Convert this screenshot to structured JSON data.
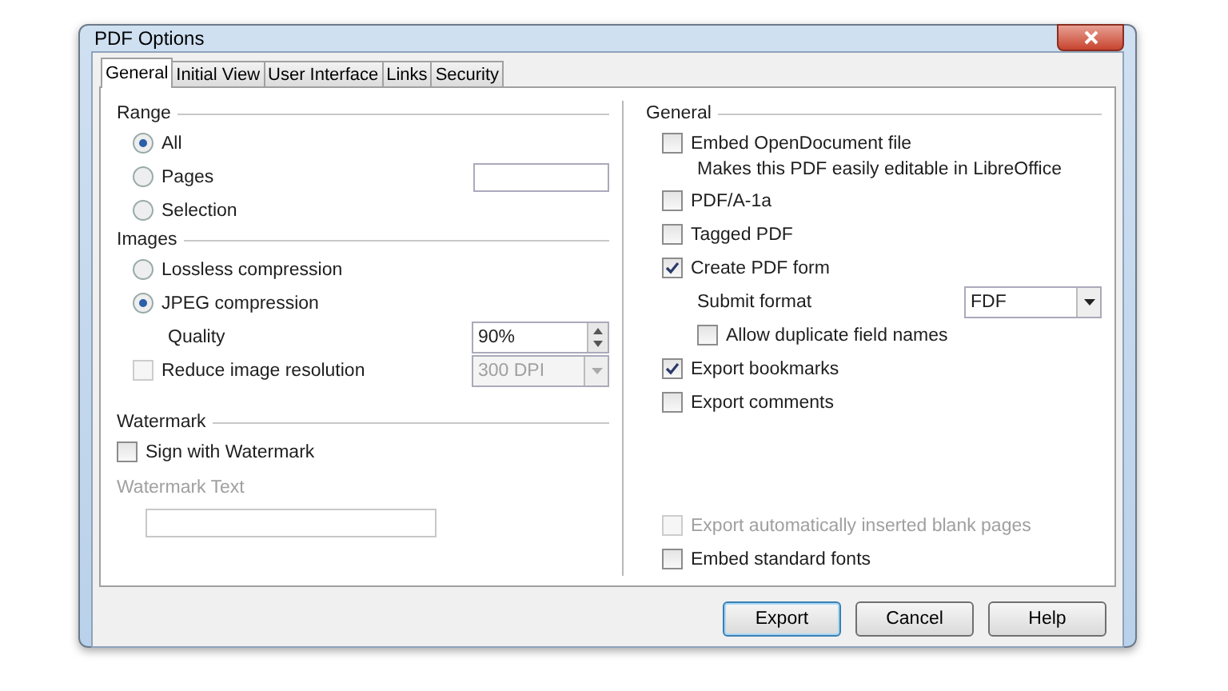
{
  "window": {
    "title": "PDF Options"
  },
  "tabs": [
    {
      "label": "General",
      "selected": true
    },
    {
      "label": "Initial View",
      "selected": false
    },
    {
      "label": "User Interface",
      "selected": false
    },
    {
      "label": "Links",
      "selected": false
    },
    {
      "label": "Security",
      "selected": false
    }
  ],
  "range": {
    "label": "Range",
    "options": [
      {
        "label": "All",
        "selected": true
      },
      {
        "label": "Pages",
        "selected": false,
        "has_field": true
      },
      {
        "label": "Selection",
        "selected": false
      }
    ]
  },
  "images": {
    "label": "Images",
    "options": [
      {
        "label": "Lossless compression",
        "selected": false
      },
      {
        "label": "JPEG compression",
        "selected": true
      }
    ],
    "quality": {
      "label": "Quality",
      "value": "90%"
    },
    "reduce": {
      "label": "Reduce image resolution",
      "checked": false,
      "value": "300 DPI",
      "disabled": true
    }
  },
  "watermark": {
    "label": "Watermark",
    "sign": {
      "label": "Sign with Watermark",
      "checked": false
    },
    "text_label": "Watermark Text",
    "text_disabled": true
  },
  "general": {
    "label": "General",
    "items": [
      {
        "kind": "checkbox",
        "label": "Embed OpenDocument file",
        "checked": false,
        "disabled": false
      },
      {
        "kind": "note",
        "label": "Makes this PDF easily editable in LibreOffice"
      },
      {
        "kind": "checkbox",
        "label": "PDF/A-1a",
        "checked": false,
        "disabled": false
      },
      {
        "kind": "checkbox",
        "label": "Tagged PDF",
        "checked": false,
        "disabled": false
      },
      {
        "kind": "checkbox",
        "label": "Create PDF form",
        "checked": true,
        "disabled": false
      },
      {
        "kind": "select",
        "label": "Submit format",
        "value": "FDF"
      },
      {
        "kind": "subcheckbox",
        "label": "Allow duplicate field names",
        "checked": false,
        "disabled": false
      },
      {
        "kind": "checkbox",
        "label": "Export bookmarks",
        "checked": true,
        "disabled": false
      },
      {
        "kind": "checkbox",
        "label": "Export comments",
        "checked": false,
        "disabled": false
      }
    ],
    "bottom_items": [
      {
        "kind": "checkbox",
        "label": "Export automatically inserted blank pages",
        "checked": false,
        "disabled": true
      },
      {
        "kind": "checkbox",
        "label": "Embed standard fonts",
        "checked": false,
        "disabled": false
      }
    ]
  },
  "buttons": [
    {
      "label": "Export",
      "default": true
    },
    {
      "label": "Cancel",
      "default": false
    },
    {
      "label": "Help",
      "default": false
    }
  ]
}
